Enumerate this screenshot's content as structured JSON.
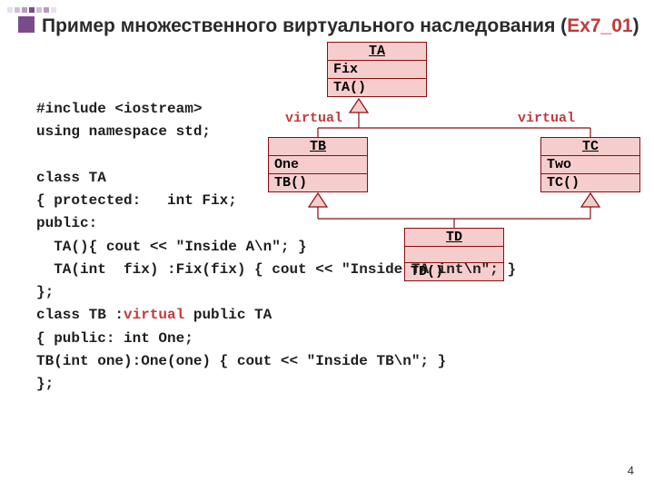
{
  "title_part1": "Пример множественного виртуального наследования (",
  "title_ex": "Ex7_01",
  "title_part2": ")",
  "page_num": "4",
  "virtual_left": "virtual",
  "virtual_right": "virtual",
  "classes": {
    "ta": {
      "name": "TA",
      "attr": "Fix",
      "op": "TA()"
    },
    "tb": {
      "name": "TB",
      "attr": "One",
      "op": "TB()"
    },
    "tc": {
      "name": "TC",
      "attr": "Two",
      "op": "TC()"
    },
    "td": {
      "name": "TD",
      "attr": "",
      "op": "TD()"
    }
  },
  "code": {
    "l1": "#include <iostream>",
    "l2": "using namespace std;",
    "l3": "",
    "l4": "class TA",
    "l5": "{ protected:   int Fix;",
    "l6": "public:",
    "l7": "  TA(){ cout << \"Inside A\\n\"; }",
    "l8": "  TA(int  fix) :Fix(fix) { cout << \"Inside TA int\\n\"; }",
    "l9": "};",
    "l10a": "class TB :",
    "l10b": "virtual",
    "l10c": " public TA",
    "l11": "{ public: int One;",
    "l12": "TB(int one):One(one) { cout << \"Inside TB\\n\"; }",
    "l13": "};"
  }
}
